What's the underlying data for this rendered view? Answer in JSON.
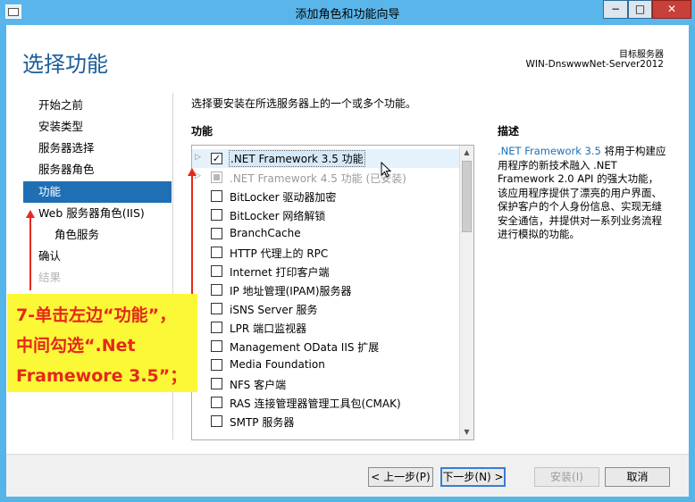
{
  "window": {
    "title": "添加角色和功能向导",
    "minimize": "−",
    "maximize": "□",
    "close": "✕"
  },
  "header": {
    "page_title": "选择功能",
    "target_label": "目标服务器",
    "target_server": "WIN-DnswwwNet-Server2012"
  },
  "nav": {
    "items": [
      {
        "label": "开始之前"
      },
      {
        "label": "安装类型"
      },
      {
        "label": "服务器选择"
      },
      {
        "label": "服务器角色"
      },
      {
        "label": "功能"
      },
      {
        "label": "Web 服务器角色(IIS)"
      },
      {
        "label": "角色服务"
      },
      {
        "label": "确认"
      },
      {
        "label": "结果"
      }
    ]
  },
  "main": {
    "instruction": "选择要安装在所选服务器上的一个或多个功能。",
    "features_label": "功能",
    "features": [
      {
        "label": ".NET Framework 3.5 功能",
        "state": "checked",
        "expander": "▷"
      },
      {
        "label": ".NET Framework 4.5 功能 (已安装)",
        "state": "partial",
        "expander": "▷"
      },
      {
        "label": "BitLocker 驱动器加密",
        "state": "unchecked"
      },
      {
        "label": "BitLocker 网络解锁",
        "state": "unchecked"
      },
      {
        "label": "BranchCache",
        "state": "unchecked"
      },
      {
        "label": "HTTP 代理上的 RPC",
        "state": "unchecked"
      },
      {
        "label": "Internet 打印客户端",
        "state": "unchecked"
      },
      {
        "label": "IP 地址管理(IPAM)服务器",
        "state": "unchecked"
      },
      {
        "label": "iSNS Server 服务",
        "state": "unchecked"
      },
      {
        "label": "LPR 端口监视器",
        "state": "unchecked"
      },
      {
        "label": "Management OData IIS 扩展",
        "state": "unchecked"
      },
      {
        "label": "Media Foundation",
        "state": "unchecked"
      },
      {
        "label": "NFS 客户端",
        "state": "unchecked"
      },
      {
        "label": "RAS 连接管理器管理工具包(CMAK)",
        "state": "unchecked"
      },
      {
        "label": "SMTP 服务器",
        "state": "unchecked"
      }
    ],
    "checkmark": "✓",
    "scroll_up": "▲",
    "scroll_down": "▼"
  },
  "description": {
    "label": "描述",
    "highlight": ".NET Framework 3.5",
    "text": " 将用于构建应用程序的新技术融入 .NET Framework 2.0 API 的强大功能，该应用程序提供了漂亮的用户界面、保护客户的个人身份信息、实现无缝安全通信，并提供对一系列业务流程进行模拟的功能。"
  },
  "footer": {
    "prev": "< 上一步(P)",
    "next": "下一步(N) >",
    "install": "安装(I)",
    "cancel": "取消"
  },
  "annotation": {
    "lines": [
      "7-单击左边“功能”，",
      "中间勾选“.Net",
      "Framewore 3.5”；"
    ]
  },
  "colors": {
    "accent": "#1f6fb5",
    "title_bar": "#5ab6ea",
    "annotation_bg": "#fbf838",
    "annotation_text": "#e5281b"
  }
}
